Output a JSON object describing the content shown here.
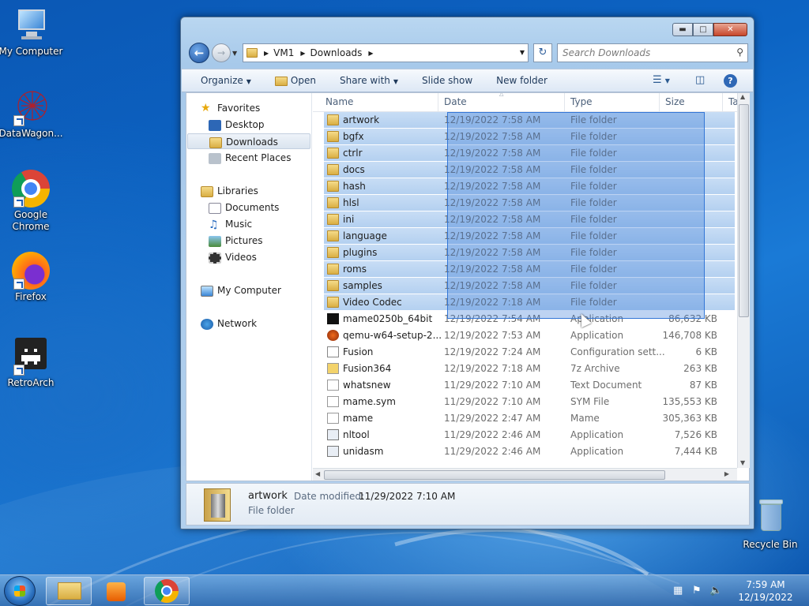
{
  "desktop": {
    "icons": [
      {
        "label": "My Computer"
      },
      {
        "label": "DataWagon..."
      },
      {
        "label": "Google Chrome"
      },
      {
        "label": "Firefox"
      },
      {
        "label": "RetroArch"
      },
      {
        "label": "Recycle Bin"
      }
    ]
  },
  "window": {
    "address": {
      "crumbs": [
        "VM1",
        "Downloads"
      ]
    },
    "search": {
      "placeholder": "Search Downloads"
    },
    "toolbar": {
      "organize": "Organize",
      "open": "Open",
      "share": "Share with",
      "slideshow": "Slide show",
      "newfolder": "New folder"
    },
    "nav": {
      "favorites": "Favorites",
      "desktop": "Desktop",
      "downloads": "Downloads",
      "recent": "Recent Places",
      "libraries": "Libraries",
      "documents": "Documents",
      "music": "Music",
      "pictures": "Pictures",
      "videos": "Videos",
      "computer": "My Computer",
      "network": "Network"
    },
    "columns": {
      "name": "Name",
      "date": "Date",
      "type": "Type",
      "size": "Size",
      "tags": "Ta"
    },
    "files": [
      {
        "name": "artwork",
        "date": "12/19/2022 7:58 AM",
        "type": "File folder",
        "size": "",
        "icon": "folder",
        "selected": true
      },
      {
        "name": "bgfx",
        "date": "12/19/2022 7:58 AM",
        "type": "File folder",
        "size": "",
        "icon": "folder",
        "selected": true
      },
      {
        "name": "ctrlr",
        "date": "12/19/2022 7:58 AM",
        "type": "File folder",
        "size": "",
        "icon": "folder",
        "selected": true
      },
      {
        "name": "docs",
        "date": "12/19/2022 7:58 AM",
        "type": "File folder",
        "size": "",
        "icon": "folder",
        "selected": true
      },
      {
        "name": "hash",
        "date": "12/19/2022 7:58 AM",
        "type": "File folder",
        "size": "",
        "icon": "folder",
        "selected": true
      },
      {
        "name": "hlsl",
        "date": "12/19/2022 7:58 AM",
        "type": "File folder",
        "size": "",
        "icon": "folder",
        "selected": true
      },
      {
        "name": "ini",
        "date": "12/19/2022 7:58 AM",
        "type": "File folder",
        "size": "",
        "icon": "folder",
        "selected": true
      },
      {
        "name": "language",
        "date": "12/19/2022 7:58 AM",
        "type": "File folder",
        "size": "",
        "icon": "folder",
        "selected": true
      },
      {
        "name": "plugins",
        "date": "12/19/2022 7:58 AM",
        "type": "File folder",
        "size": "",
        "icon": "folder",
        "selected": true
      },
      {
        "name": "roms",
        "date": "12/19/2022 7:58 AM",
        "type": "File folder",
        "size": "",
        "icon": "folder",
        "selected": true
      },
      {
        "name": "samples",
        "date": "12/19/2022 7:58 AM",
        "type": "File folder",
        "size": "",
        "icon": "folder",
        "selected": true
      },
      {
        "name": "Video Codec",
        "date": "12/19/2022 7:18 AM",
        "type": "File folder",
        "size": "",
        "icon": "folder",
        "selected": true
      },
      {
        "name": "mame0250b_64bit",
        "date": "12/19/2022 7:54 AM",
        "type": "Application",
        "size": "86,632 KB",
        "icon": "7z-exe",
        "selected": false
      },
      {
        "name": "qemu-w64-setup-2...",
        "date": "12/19/2022 7:53 AM",
        "type": "Application",
        "size": "146,708 KB",
        "icon": "qemu",
        "selected": false
      },
      {
        "name": "Fusion",
        "date": "12/19/2022 7:24 AM",
        "type": "Configuration sett...",
        "size": "6 KB",
        "icon": "config",
        "selected": false
      },
      {
        "name": "Fusion364",
        "date": "12/19/2022 7:18 AM",
        "type": "7z Archive",
        "size": "263 KB",
        "icon": "7z",
        "selected": false
      },
      {
        "name": "whatsnew",
        "date": "11/29/2022 7:10 AM",
        "type": "Text Document",
        "size": "87 KB",
        "icon": "text",
        "selected": false
      },
      {
        "name": "mame.sym",
        "date": "11/29/2022 7:10 AM",
        "type": "SYM File",
        "size": "135,553 KB",
        "icon": "file",
        "selected": false
      },
      {
        "name": "mame",
        "date": "11/29/2022 2:47 AM",
        "type": "Mame",
        "size": "305,363 KB",
        "icon": "mame",
        "selected": false
      },
      {
        "name": "nltool",
        "date": "11/29/2022 2:46 AM",
        "type": "Application",
        "size": "7,526 KB",
        "icon": "app",
        "selected": false
      },
      {
        "name": "unidasm",
        "date": "11/29/2022 2:46 AM",
        "type": "Application",
        "size": "7,444 KB",
        "icon": "app",
        "selected": false
      }
    ],
    "details": {
      "name": "artwork",
      "date_label": "Date modified:",
      "date": "11/29/2022 7:10 AM",
      "type": "File folder"
    }
  },
  "taskbar": {
    "time": "7:59 AM",
    "date": "12/19/2022"
  }
}
